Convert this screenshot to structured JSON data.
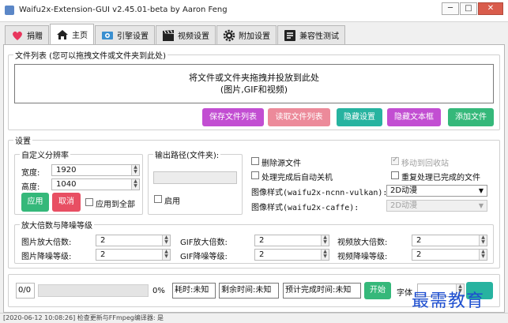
{
  "window": {
    "title": "Waifu2x-Extension-GUI v2.45.01-beta by Aaron Feng",
    "min_label": "─",
    "max_label": "□",
    "close_label": "✕"
  },
  "tabs": [
    {
      "label": "捐赠",
      "icon": "heart-icon"
    },
    {
      "label": "主页",
      "icon": "home-icon"
    },
    {
      "label": "引擎设置",
      "icon": "engine-icon"
    },
    {
      "label": "视频设置",
      "icon": "film-icon"
    },
    {
      "label": "附加设置",
      "icon": "gear-icon"
    },
    {
      "label": "兼容性测试",
      "icon": "test-icon"
    }
  ],
  "file_list": {
    "title": "文件列表 (您可以拖拽文件或文件夹到此处)",
    "drop_line1": "将文件或文件夹拖拽并投放到此处",
    "drop_line2": "(图片,GIF和视频)",
    "buttons": {
      "save_list": "保存文件列表",
      "load_list": "读取文件列表",
      "hide_settings": "隐藏设置",
      "hide_textbox": "隐藏文本框",
      "add_file": "添加文件"
    }
  },
  "settings": {
    "title": "设置",
    "resolution": {
      "title": "自定义分辨率",
      "width_label": "宽度:",
      "width_value": "1920",
      "height_label": "高度:",
      "height_value": "1040",
      "apply": "应用",
      "cancel": "取消",
      "apply_all": "应用到全部"
    },
    "output": {
      "title": "输出路径(文件夹):",
      "enable": "启用"
    },
    "options": {
      "delete_source": "删除源文件",
      "move_to_recycle": "移动到回收站",
      "shutdown": "处理完成后自动关机",
      "reprocess": "重复处理已完成的文件",
      "style_ncnn_label": "图像样式(waifu2x-ncnn-vulkan):",
      "style_ncnn_value": "2D动漫",
      "style_caffe_label": "图像样式(waifu2x-caffe):",
      "style_caffe_value": "2D动漫"
    },
    "scale_noise": {
      "title": "放大倍数与降噪等级",
      "image_scale_label": "图片放大倍数:",
      "image_scale_value": "2",
      "image_noise_label": "图片降噪等级:",
      "image_noise_value": "2",
      "gif_scale_label": "GIF放大倍数:",
      "gif_scale_value": "2",
      "gif_noise_label": "GIF降噪等级:",
      "gif_noise_value": "2",
      "video_scale_label": "视频放大倍数:",
      "video_scale_value": "2",
      "video_noise_label": "视频降噪等级:",
      "video_noise_value": "2"
    }
  },
  "progress": {
    "count": "0/0",
    "percent": "0%",
    "percent_value": 0,
    "elapsed": "耗时:未知",
    "remaining": "剩余时间:未知",
    "eta": "预计完成时间:未知",
    "start": "开始",
    "font_label": "字体"
  },
  "status_text": "[2020-06-12 10:08:26] 检查更新与FFmpeg编译器: 是",
  "watermark": "最需教育",
  "colors": {
    "purple": "#c24ed2",
    "pink": "#ec8a9a",
    "teal": "#27b3a0",
    "green": "#35b87a",
    "red": "#e84f63",
    "watermark": "#1e4fd0"
  }
}
